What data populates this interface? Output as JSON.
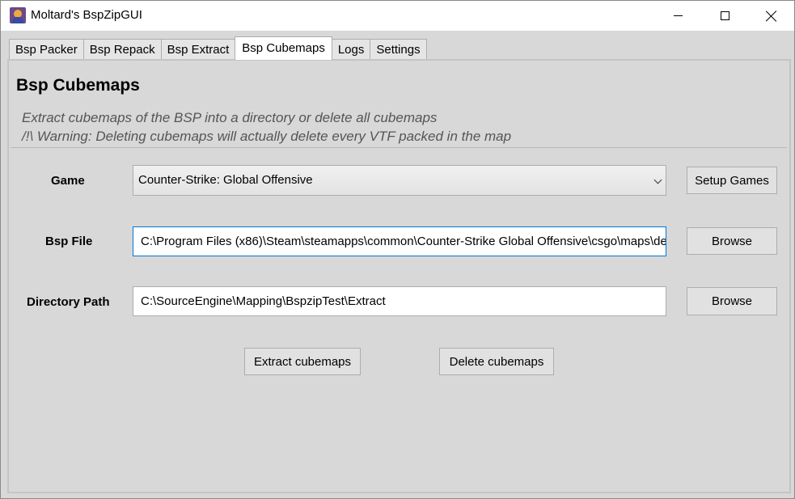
{
  "window": {
    "title": "Moltard's BspZipGUI"
  },
  "tabs": [
    {
      "label": "Bsp Packer",
      "active": false
    },
    {
      "label": "Bsp Repack",
      "active": false
    },
    {
      "label": "Bsp Extract",
      "active": false
    },
    {
      "label": "Bsp Cubemaps",
      "active": true
    },
    {
      "label": "Logs",
      "active": false
    },
    {
      "label": "Settings",
      "active": false
    }
  ],
  "page": {
    "title": "Bsp Cubemaps",
    "description_line1": "Extract cubemaps of the BSP into a directory or delete all cubemaps",
    "description_line2": "/!\\ Warning: Deleting cubemaps will actually delete every VTF packed in the map"
  },
  "form": {
    "game_label": "Game",
    "game_value": "Counter-Strike: Global Offensive",
    "setup_games_label": "Setup Games",
    "bsp_label": "Bsp File",
    "bsp_value": "C:\\Program Files (x86)\\Steam\\steamapps\\common\\Counter-Strike Global Offensive\\csgo\\maps\\de",
    "browse_label": "Browse",
    "dir_label": "Directory Path",
    "dir_value": "C:\\SourceEngine\\Mapping\\BspzipTest\\Extract"
  },
  "actions": {
    "extract_label": "Extract cubemaps",
    "delete_label": "Delete cubemaps"
  },
  "colors": {
    "focus_border": "#0078d7",
    "window_bg": "#d8d8d8"
  }
}
